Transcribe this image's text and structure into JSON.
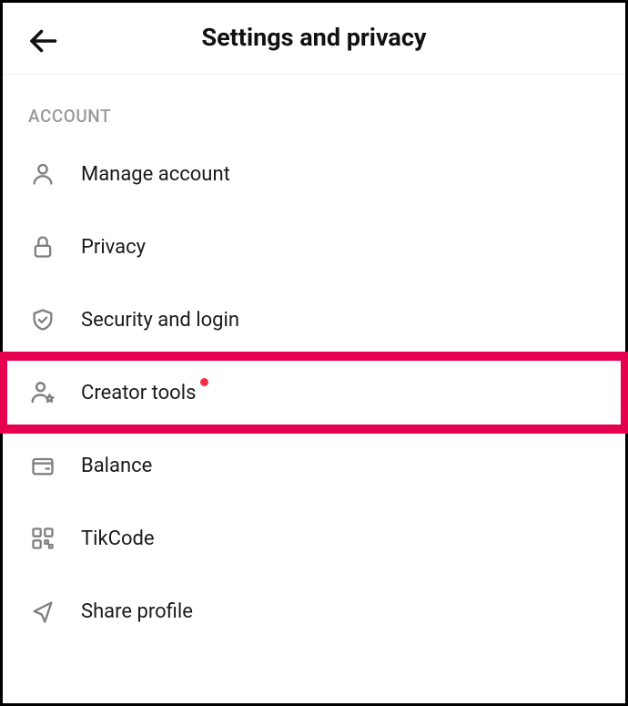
{
  "header": {
    "title": "Settings and privacy"
  },
  "section": {
    "label": "ACCOUNT"
  },
  "menu": {
    "items": [
      {
        "label": "Manage account"
      },
      {
        "label": "Privacy"
      },
      {
        "label": "Security and login"
      },
      {
        "label": "Creator tools"
      },
      {
        "label": "Balance"
      },
      {
        "label": "TikCode"
      },
      {
        "label": "Share profile"
      }
    ]
  }
}
